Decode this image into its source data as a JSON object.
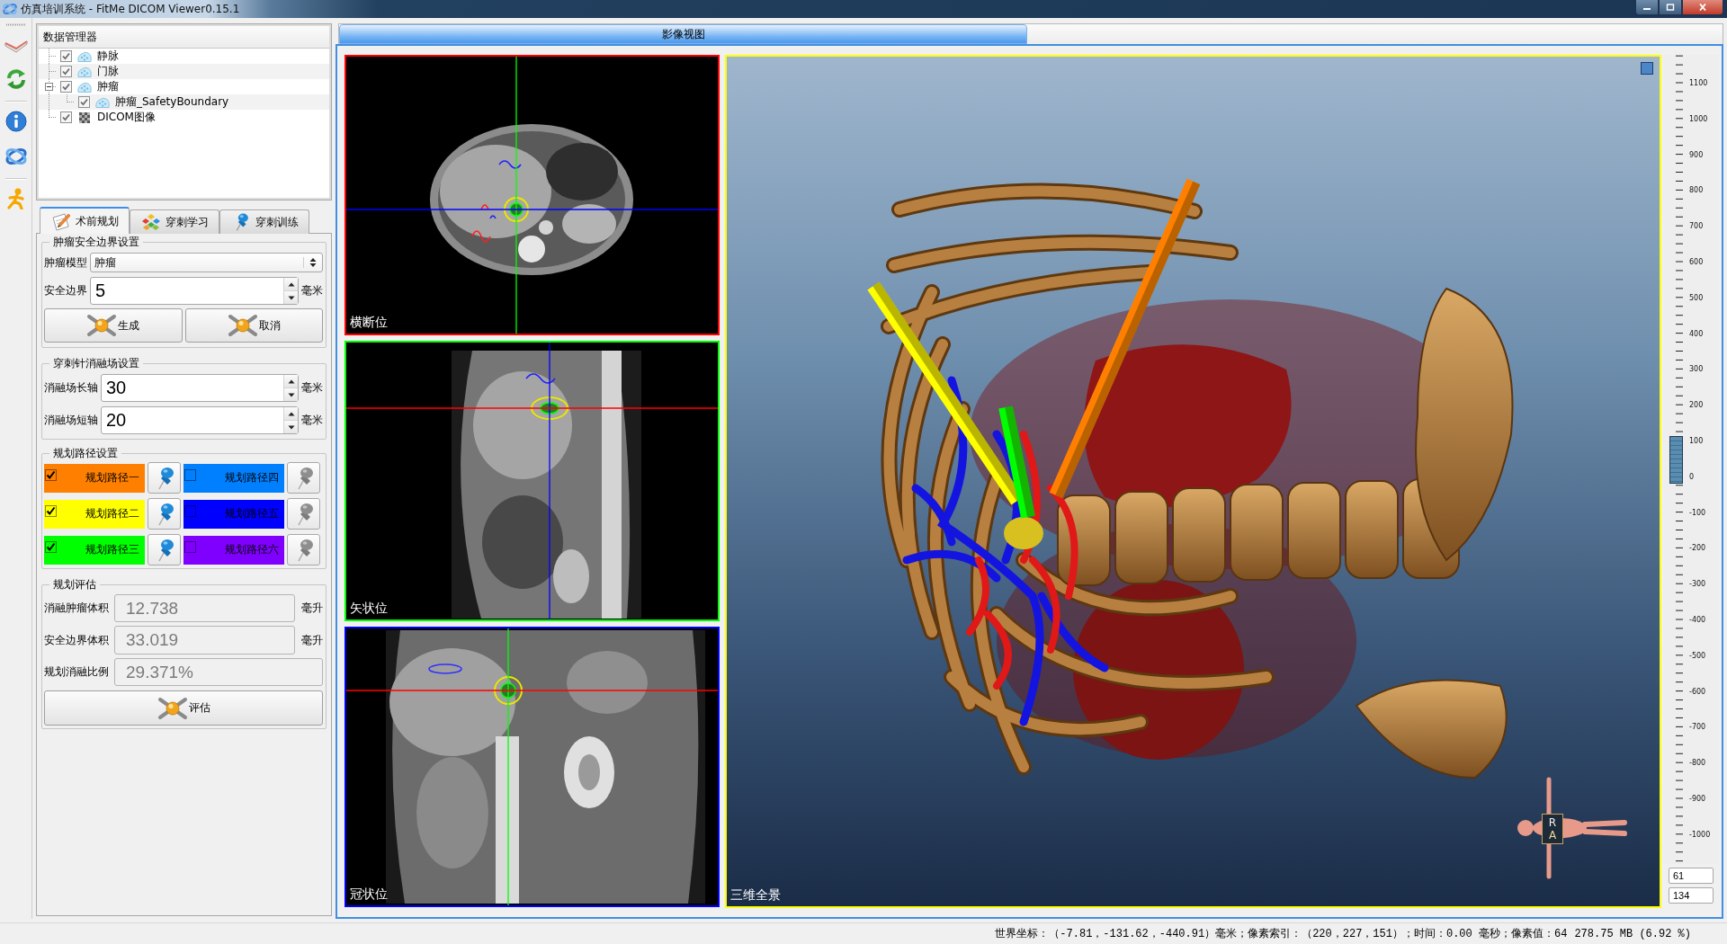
{
  "window": {
    "title": "仿真培训系统 - FitMe DICOM Viewer0.15.1"
  },
  "data_manager": {
    "title": "数据管理器",
    "tree": [
      {
        "label": "静脉",
        "kind": "mesh",
        "checked": true
      },
      {
        "label": "门脉",
        "kind": "mesh",
        "checked": true
      },
      {
        "label": "肿瘤",
        "kind": "mesh",
        "checked": true,
        "expanded": true,
        "children": [
          {
            "label": "肿瘤_SafetyBoundary",
            "kind": "mesh",
            "checked": true
          }
        ]
      },
      {
        "label": "DICOM图像",
        "kind": "image",
        "checked": true
      }
    ]
  },
  "tabs": [
    {
      "label": "术前规划",
      "selected": true
    },
    {
      "label": "穿刺学习",
      "selected": false
    },
    {
      "label": "穿刺训练",
      "selected": false
    }
  ],
  "tumor_margin": {
    "title": "肿瘤安全边界设置",
    "model": {
      "label": "肿瘤模型",
      "value": "肿瘤"
    },
    "margin": {
      "label": "安全边界",
      "value": "5",
      "unit": "毫米"
    },
    "buttons": [
      "生成",
      "取消"
    ]
  },
  "ablation_zone": {
    "title": "穿刺针消融场设置",
    "fields": [
      {
        "label": "消融场长轴",
        "value": "30",
        "unit": "毫米"
      },
      {
        "label": "消融场短轴",
        "value": "20",
        "unit": "毫米"
      }
    ]
  },
  "paths": {
    "title": "规划路径设置",
    "items": [
      {
        "label": "规划路径一",
        "color": "#ff8000",
        "checked": true
      },
      {
        "label": "规划路径二",
        "color": "#ffff00",
        "checked": true
      },
      {
        "label": "规划路径三",
        "color": "#00ff00",
        "checked": true
      },
      {
        "label": "规划路径四",
        "color": "#0080ff",
        "checked": false
      },
      {
        "label": "规划路径五",
        "color": "#0000ff",
        "checked": false
      },
      {
        "label": "规划路径六",
        "color": "#8000ff",
        "checked": false
      }
    ]
  },
  "evaluation": {
    "title": "规划评估",
    "fields": [
      {
        "label": "消融肿瘤体积",
        "value": "12.738",
        "unit": "毫升",
        "disabled": true
      },
      {
        "label": "安全边界体积",
        "value": "33.019",
        "unit": "毫升",
        "disabled": true
      },
      {
        "label": "规划消融比例",
        "value": "29.371%",
        "disabled": true
      }
    ],
    "button": "评估"
  },
  "image_view": {
    "tab": {
      "label": "影像视图",
      "selected": true
    },
    "viewports": [
      {
        "kind": "axial",
        "label": "横断位",
        "color": "#ff0000"
      },
      {
        "kind": "sagittal",
        "label": "矢状位",
        "color": "#00ff00"
      },
      {
        "kind": "coronal",
        "label": "冠状位",
        "color": "#0000ff"
      },
      {
        "kind": "volume",
        "label": "三维全景",
        "color": "#ffff00"
      }
    ],
    "orientation_labels": [
      "R",
      "A"
    ],
    "ruler": {
      "labels": [
        "1100",
        "1000",
        "900",
        "800",
        "700",
        "600",
        "500",
        "400",
        "300",
        "200",
        "100",
        "0",
        "-100",
        "-200",
        "-300",
        "-400",
        "-500",
        "-600",
        "-700",
        "-800",
        "-900",
        "-1000"
      ],
      "level": 0.5
    },
    "window_fields": [
      "61",
      "134"
    ]
  },
  "status_bar": {
    "text": "世界坐标：（-7.81，-131.62，-440.91）毫米；像素索引：（220，227，151）；时间：0.00 毫秒；像素值：64",
    "memory": "278.75 MB (6.92 %)"
  }
}
